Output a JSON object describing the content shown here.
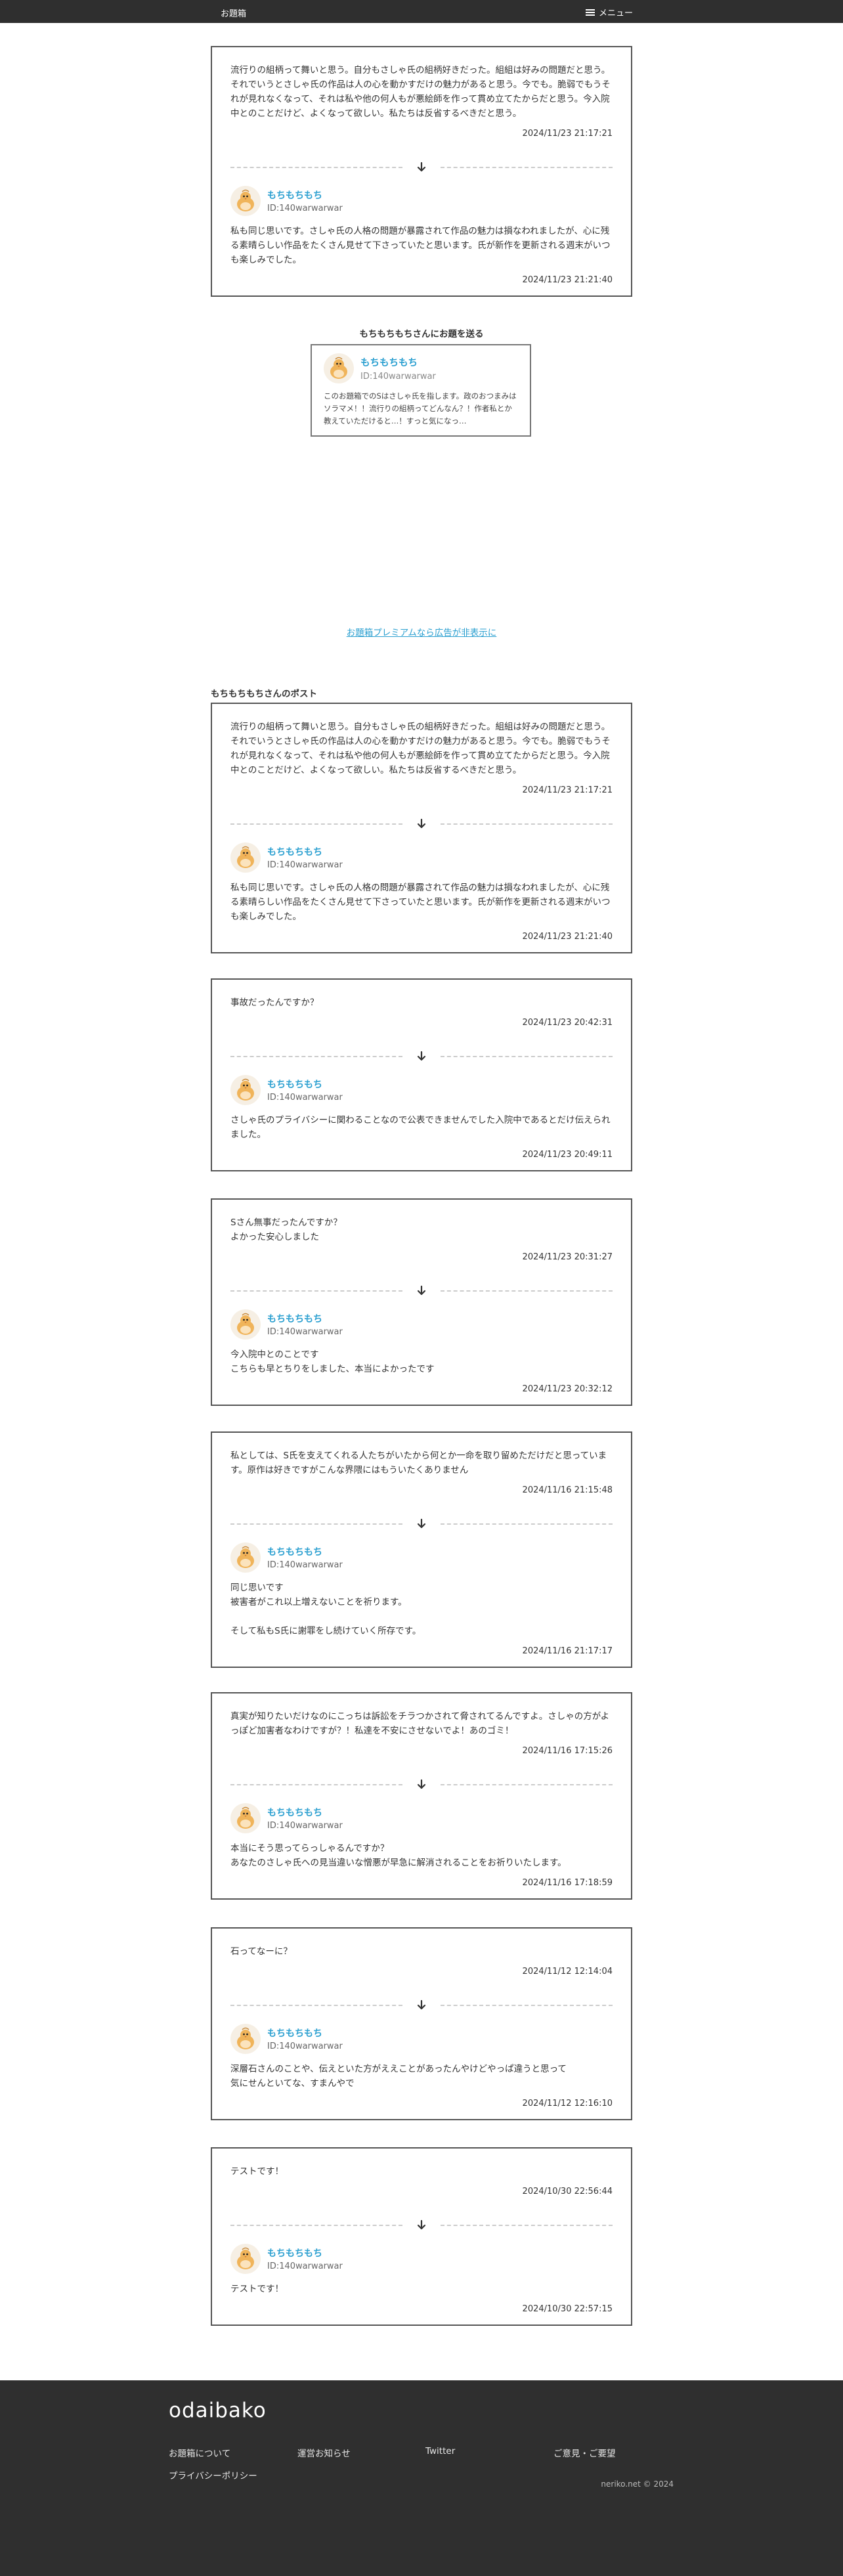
{
  "header": {
    "brand": "お題箱",
    "menu_label": "メニュー"
  },
  "featured": {
    "question": "流行りの組柄って舞いと思う。自分もさしゃ氏の組柄好きだった。組組は好みの問題だと思う。それでいうとさしゃ氏の作品は人の心を動かすだけの魅力があると思う。今でも。脆弱でもうそれが見れなくなって、それは私や他の何人もが悪絵師を作って貫め立てたからだと思う。今入院中とのことだけど、よくなって欲しい。私たちは反省するべきだと思う。",
    "question_time": "2024/11/23 21:17:21",
    "answerer_name": "もちもちもち",
    "answerer_id": "ID:140warwarwar",
    "answer": "私も同じ思いです。さしゃ氏の人格の問題が暴露されて作品の魅力は損なわれましたが、心に残る素晴らしい作品をたくさん見せて下さっていたと思います。氏が新作を更新される週末がいつも楽しみでした。",
    "answer_time": "2024/11/23 21:21:40"
  },
  "send": {
    "title": "もちもちもちさんにお題を送る",
    "profile_name": "もちもちもち",
    "profile_id": "ID:140warwarwar",
    "profile_bio": "このお題箱でのSはさしゃ氏を指します。政のおつまみはソラマメ！！流行りの組柄ってどんなん？！作者私とか教えていただけると…！すっと気になっ…"
  },
  "premium_link": "お題箱プレミアムなら広告が非表示に",
  "posts_title": "もちもちもちさんのポスト",
  "posts": [
    {
      "question": "流行りの組柄って舞いと思う。自分もさしゃ氏の組柄好きだった。組組は好みの問題だと思う。それでいうとさしゃ氏の作品は人の心を動かすだけの魅力があると思う。今でも。脆弱でもうそれが見れなくなって、それは私や他の何人もが悪絵師を作って貫め立てたからだと思う。今入院中とのことだけど、よくなって欲しい。私たちは反省するべきだと思う。",
      "question_time": "2024/11/23 21:17:21",
      "answerer_name": "もちもちもち",
      "answerer_id": "ID:140warwarwar",
      "answer": "私も同じ思いです。さしゃ氏の人格の問題が暴露されて作品の魅力は損なわれましたが、心に残る素晴らしい作品をたくさん見せて下さっていたと思います。氏が新作を更新される週末がいつも楽しみでした。",
      "answer_time": "2024/11/23 21:21:40"
    },
    {
      "question": "事故だったんですか？",
      "question_time": "2024/11/23 20:42:31",
      "answerer_name": "もちもちもち",
      "answerer_id": "ID:140warwarwar",
      "answer": "さしゃ氏のプライバシーに関わることなので公表できませんでした入院中であるとだけ伝えられました。",
      "answer_time": "2024/11/23 20:49:11"
    },
    {
      "question": "Sさん無事だったんですか？\nよかった安心しました",
      "question_time": "2024/11/23 20:31:27",
      "answerer_name": "もちもちもち",
      "answerer_id": "ID:140warwarwar",
      "answer": "今入院中とのことです\nこちらも早とちりをしました、本当によかったです",
      "answer_time": "2024/11/23 20:32:12"
    },
    {
      "question": "私としては、S氏を支えてくれる人たちがいたから何とか一命を取り留めただけだと思っています。原作は好きですがこんな界隈にはもういたくありません",
      "question_time": "2024/11/16 21:15:48",
      "answerer_name": "もちもちもち",
      "answerer_id": "ID:140warwarwar",
      "answer": "同じ思いです\n被害者がこれ以上増えないことを祈ります。\n\nそして私もS氏に謝罪をし続けていく所存です。",
      "answer_time": "2024/11/16 21:17:17"
    },
    {
      "question": "真実が知りたいだけなのにこっちは訴訟をチラつかされて脅されてるんですよ。さしゃの方がよっぽど加害者なわけですが？！私達を不安にさせないでよ！あのゴミ！",
      "question_time": "2024/11/16 17:15:26",
      "answerer_name": "もちもちもち",
      "answerer_id": "ID:140warwarwar",
      "answer": "本当にそう思ってらっしゃるんですか？\nあなたのさしゃ氏への見当違いな憎悪が早急に解消されることをお祈りいたします。",
      "answer_time": "2024/11/16 17:18:59"
    },
    {
      "question": "石ってなーに？",
      "question_time": "2024/11/12 12:14:04",
      "answerer_name": "もちもちもち",
      "answerer_id": "ID:140warwarwar",
      "answer": "深層石さんのことや、伝えといた方がええことがあったんやけどやっぱ違うと思って\n気にせんといてな、すまんやで",
      "answer_time": "2024/11/12 12:16:10"
    },
    {
      "question": "テストです！",
      "question_time": "2024/10/30 22:56:44",
      "answerer_name": "もちもちもち",
      "answerer_id": "ID:140warwarwar",
      "answer": "テストです！",
      "answer_time": "2024/10/30 22:57:15"
    }
  ],
  "footer": {
    "logo": "odaibako",
    "links": {
      "about": "お題箱について",
      "news": "運営お知らせ",
      "twitter": "Twitter",
      "feedback": "ご意見・ご要望",
      "privacy": "プライバシーポリシー"
    },
    "copyright": "neriko.net © 2024"
  },
  "colors": {
    "header_bg": "#2f2f2f",
    "accent": "#2a9fd0",
    "card_border": "#555555"
  }
}
